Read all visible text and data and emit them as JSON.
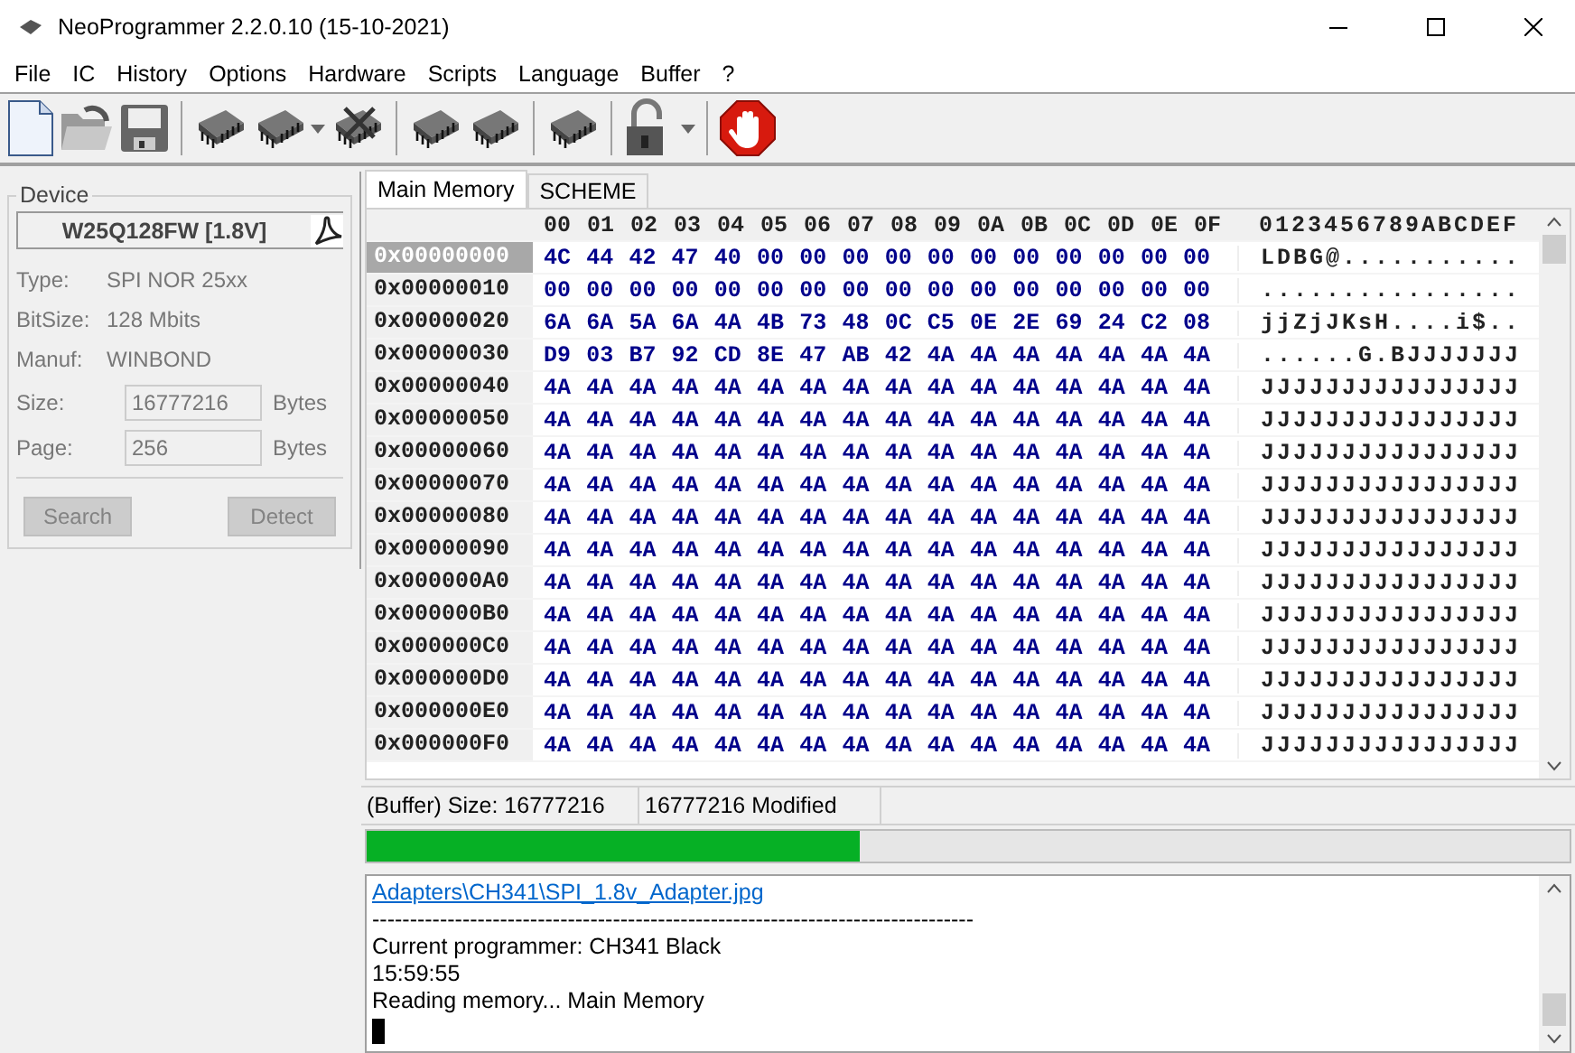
{
  "window": {
    "title": "NeoProgrammer 2.2.0.10 (15-10-2021)"
  },
  "menu": [
    "File",
    "IC",
    "History",
    "Options",
    "Hardware",
    "Scripts",
    "Language",
    "Buffer",
    "?"
  ],
  "toolbar": [
    {
      "kind": "new"
    },
    {
      "kind": "open"
    },
    {
      "kind": "save"
    },
    {
      "kind": "sep"
    },
    {
      "kind": "chip"
    },
    {
      "kind": "chip",
      "dropdown": true
    },
    {
      "kind": "chip-x"
    },
    {
      "kind": "sep"
    },
    {
      "kind": "chip"
    },
    {
      "kind": "chip"
    },
    {
      "kind": "sep"
    },
    {
      "kind": "chip"
    },
    {
      "kind": "sep"
    },
    {
      "kind": "lock",
      "dropdown": true
    },
    {
      "kind": "sep"
    },
    {
      "kind": "stop"
    }
  ],
  "device": {
    "legend": "Device",
    "name": "W25Q128FW [1.8V]",
    "info": [
      {
        "label": "Type:",
        "value": "SPI NOR 25xx"
      },
      {
        "label": "BitSize:",
        "value": "128 Mbits"
      },
      {
        "label": "Manuf:",
        "value": "WINBOND"
      }
    ],
    "fields": [
      {
        "label": "Size:",
        "value": "16777216",
        "unit": "Bytes"
      },
      {
        "label": "Page:",
        "value": "256",
        "unit": "Bytes"
      }
    ],
    "buttons": [
      {
        "label": "Search",
        "disabled": true
      },
      {
        "label": "Detect",
        "disabled": true
      }
    ]
  },
  "tabs": [
    {
      "label": "Main Memory",
      "selected": true
    },
    {
      "label": "SCHEME",
      "selected": false
    }
  ],
  "hex": {
    "columns": [
      "00",
      "01",
      "02",
      "03",
      "04",
      "05",
      "06",
      "07",
      "08",
      "09",
      "0A",
      "0B",
      "0C",
      "0D",
      "0E",
      "0F"
    ],
    "ascii_header": "0123456789ABCDEF",
    "rows": [
      {
        "address": "0x00000000",
        "selected": true,
        "bytes": "4C 44 42 47 40 00 00 00 00 00 00 00 00 00 00 00",
        "ascii": "LDBG@..........."
      },
      {
        "address": "0x00000010",
        "selected": false,
        "bytes": "00 00 00 00 00 00 00 00 00 00 00 00 00 00 00 00",
        "ascii": "................"
      },
      {
        "address": "0x00000020",
        "selected": false,
        "bytes": "6A 6A 5A 6A 4A 4B 73 48 0C C5 0E 2E 69 24 C2 08",
        "ascii": "jjZjJKsH....i$.."
      },
      {
        "address": "0x00000030",
        "selected": false,
        "bytes": "D9 03 B7 92 CD 8E 47 AB 42 4A 4A 4A 4A 4A 4A 4A",
        "ascii": "......G.BJJJJJJJ"
      },
      {
        "address": "0x00000040",
        "selected": false,
        "bytes": "4A 4A 4A 4A 4A 4A 4A 4A 4A 4A 4A 4A 4A 4A 4A 4A",
        "ascii": "JJJJJJJJJJJJJJJJ"
      },
      {
        "address": "0x00000050",
        "selected": false,
        "bytes": "4A 4A 4A 4A 4A 4A 4A 4A 4A 4A 4A 4A 4A 4A 4A 4A",
        "ascii": "JJJJJJJJJJJJJJJJ"
      },
      {
        "address": "0x00000060",
        "selected": false,
        "bytes": "4A 4A 4A 4A 4A 4A 4A 4A 4A 4A 4A 4A 4A 4A 4A 4A",
        "ascii": "JJJJJJJJJJJJJJJJ"
      },
      {
        "address": "0x00000070",
        "selected": false,
        "bytes": "4A 4A 4A 4A 4A 4A 4A 4A 4A 4A 4A 4A 4A 4A 4A 4A",
        "ascii": "JJJJJJJJJJJJJJJJ"
      },
      {
        "address": "0x00000080",
        "selected": false,
        "bytes": "4A 4A 4A 4A 4A 4A 4A 4A 4A 4A 4A 4A 4A 4A 4A 4A",
        "ascii": "JJJJJJJJJJJJJJJJ"
      },
      {
        "address": "0x00000090",
        "selected": false,
        "bytes": "4A 4A 4A 4A 4A 4A 4A 4A 4A 4A 4A 4A 4A 4A 4A 4A",
        "ascii": "JJJJJJJJJJJJJJJJ"
      },
      {
        "address": "0x000000A0",
        "selected": false,
        "bytes": "4A 4A 4A 4A 4A 4A 4A 4A 4A 4A 4A 4A 4A 4A 4A 4A",
        "ascii": "JJJJJJJJJJJJJJJJ"
      },
      {
        "address": "0x000000B0",
        "selected": false,
        "bytes": "4A 4A 4A 4A 4A 4A 4A 4A 4A 4A 4A 4A 4A 4A 4A 4A",
        "ascii": "JJJJJJJJJJJJJJJJ"
      },
      {
        "address": "0x000000C0",
        "selected": false,
        "bytes": "4A 4A 4A 4A 4A 4A 4A 4A 4A 4A 4A 4A 4A 4A 4A 4A",
        "ascii": "JJJJJJJJJJJJJJJJ"
      },
      {
        "address": "0x000000D0",
        "selected": false,
        "bytes": "4A 4A 4A 4A 4A 4A 4A 4A 4A 4A 4A 4A 4A 4A 4A 4A",
        "ascii": "JJJJJJJJJJJJJJJJ"
      },
      {
        "address": "0x000000E0",
        "selected": false,
        "bytes": "4A 4A 4A 4A 4A 4A 4A 4A 4A 4A 4A 4A 4A 4A 4A 4A",
        "ascii": "JJJJJJJJJJJJJJJJ"
      },
      {
        "address": "0x000000F0",
        "selected": false,
        "bytes": "4A 4A 4A 4A 4A 4A 4A 4A 4A 4A 4A 4A 4A 4A 4A 4A",
        "ascii": "JJJJJJJJJJJJJJJJ"
      }
    ]
  },
  "status_bar": [
    "(Buffer) Size: 16777216",
    "16777216 Modified"
  ],
  "progress": {
    "level": 0.41
  },
  "log": [
    {
      "kind": "link",
      "text": "Adapters\\CH341\\SPI_1.8v_Adapter.jpg"
    },
    {
      "kind": "text",
      "text": "--------------------------------------------------------------------------------"
    },
    {
      "kind": "text",
      "text": "Current programmer: CH341 Black"
    },
    {
      "kind": "text",
      "text": "15:59:55"
    },
    {
      "kind": "text",
      "text": "Reading memory... Main Memory"
    },
    {
      "kind": "cursor"
    }
  ]
}
